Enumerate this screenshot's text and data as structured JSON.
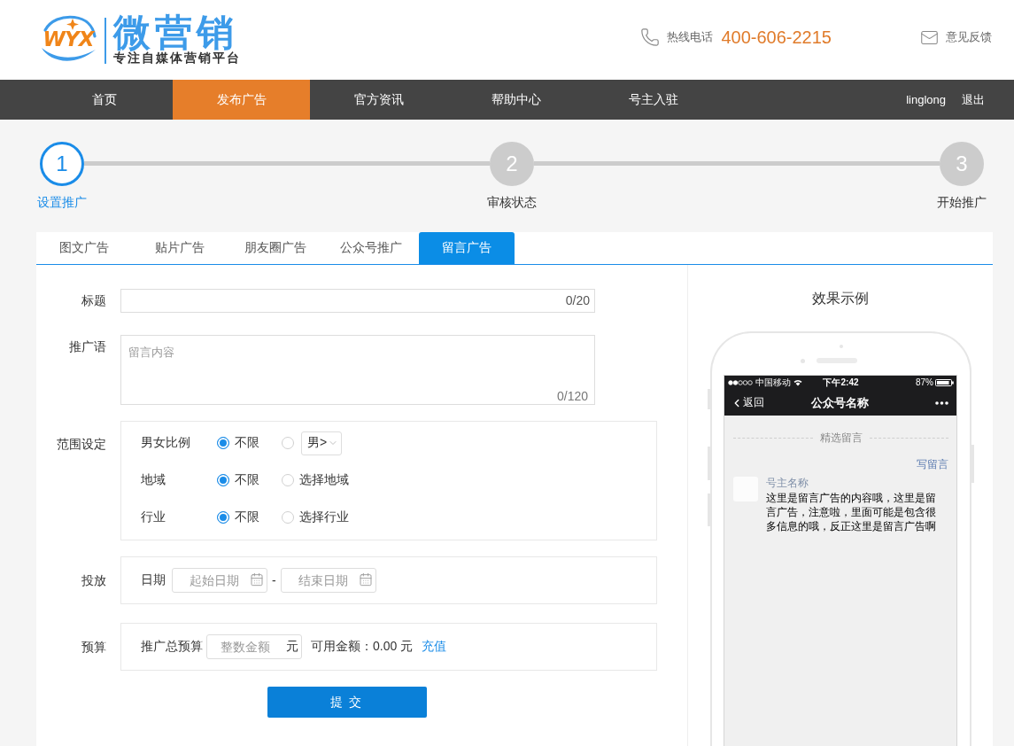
{
  "header": {
    "logo": {
      "mark": "WYX",
      "name": "微营销",
      "slogan": "专注自媒体营销平台"
    },
    "hotline": {
      "label": "热线电话",
      "number": "400-606-2215"
    },
    "feedback": "意见反馈"
  },
  "nav": {
    "items": [
      {
        "label": "首页",
        "selected": false
      },
      {
        "label": "发布广告",
        "selected": true
      },
      {
        "label": "官方资讯",
        "selected": false
      },
      {
        "label": "帮助中心",
        "selected": false
      },
      {
        "label": "号主入驻",
        "selected": false
      }
    ],
    "user": "linglong",
    "logout": "退出"
  },
  "steps": [
    {
      "number": "1",
      "label": "设置推广",
      "current": true
    },
    {
      "number": "2",
      "label": "审核状态",
      "current": false
    },
    {
      "number": "3",
      "label": "开始推广",
      "current": false
    }
  ],
  "tabs": [
    {
      "label": "图文广告",
      "selected": false
    },
    {
      "label": "贴片广告",
      "selected": false
    },
    {
      "label": "朋友圈广告",
      "selected": false
    },
    {
      "label": "公众号推广",
      "selected": false
    },
    {
      "label": "留言广告",
      "selected": true
    }
  ],
  "form": {
    "title": {
      "label": "标题",
      "counter": "0/20"
    },
    "promo_text": {
      "label": "推广语",
      "placeholder": "留言内容",
      "counter": "0/120"
    },
    "scope": {
      "label": "范围设定",
      "rows": [
        {
          "label": "男女比例",
          "options": [
            {
              "kind": "text",
              "label": "不限",
              "selected": true
            },
            {
              "kind": "select",
              "value": "男>",
              "selected": false
            }
          ]
        },
        {
          "label": "地域",
          "options": [
            {
              "kind": "text",
              "label": "不限",
              "selected": true
            },
            {
              "kind": "text",
              "label": "选择地域",
              "selected": false
            }
          ]
        },
        {
          "label": "行业",
          "options": [
            {
              "kind": "text",
              "label": "不限",
              "selected": true
            },
            {
              "kind": "text",
              "label": "选择行业",
              "selected": false
            }
          ]
        }
      ]
    },
    "delivery": {
      "label": "投放",
      "date_label": "日期",
      "start_placeholder": "起始日期",
      "separator": "-",
      "end_placeholder": "结束日期"
    },
    "budget": {
      "label": "预算",
      "field_label": "推广总预算",
      "placeholder": "整数金额",
      "unit": "元",
      "balance": "可用金额：0.00 元",
      "recharge": "充值"
    },
    "submit": "提 交"
  },
  "preview": {
    "title": "效果示例",
    "phone": {
      "carrier": "中国移动",
      "time": "下午2:42",
      "battery": "87%",
      "back": "返回",
      "account": "公众号名称",
      "section": "精选留言",
      "write_comment": "写留言",
      "comment": {
        "author": "号主名称",
        "text": "这里是留言广告的内容哦，这里是留言广告，注意啦，里面可能是包含很多信息的哦，反正这里是留言广告啊"
      }
    }
  }
}
